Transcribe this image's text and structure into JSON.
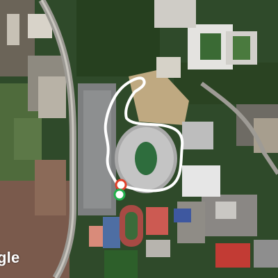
{
  "map": {
    "type": "satellite",
    "attribution": "gle",
    "colors": {
      "vegetation": "#2f4a2a",
      "route_line": "#ffffff",
      "start_marker": "#22b14c",
      "end_marker": "#e0402a"
    }
  },
  "route": {
    "has_start_marker": true,
    "has_end_marker": true
  }
}
